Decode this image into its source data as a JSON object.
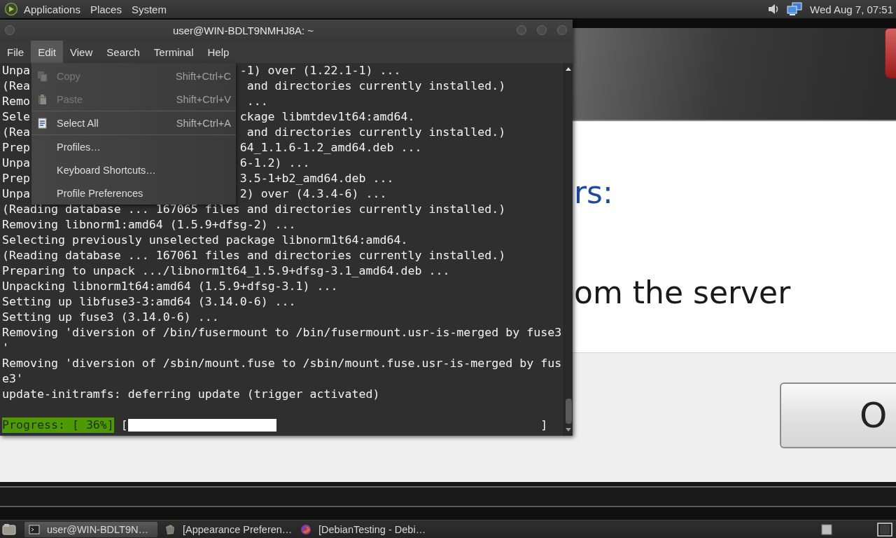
{
  "top_panel": {
    "menus": [
      "Applications",
      "Places",
      "System"
    ],
    "clock": "Wed Aug 7, 07:51"
  },
  "background_dialog": {
    "heading": "rs:",
    "message": "om the server",
    "button": "O"
  },
  "terminal": {
    "title": "user@WIN-BDLT9NMHJ8A: ~",
    "menubar": [
      {
        "label": "File",
        "selected": false
      },
      {
        "label": "Edit",
        "selected": true
      },
      {
        "label": "View",
        "selected": false
      },
      {
        "label": "Search",
        "selected": false
      },
      {
        "label": "Terminal",
        "selected": false
      },
      {
        "label": "Help",
        "selected": false
      }
    ],
    "lines": [
      {
        "left": "Unpa",
        "right": "-1) over (1.22.1-1) ..."
      },
      {
        "left": "(Rea",
        "right": " and directories currently installed.)"
      },
      {
        "left": "Remo",
        "right": " ..."
      },
      {
        "left": "Sele",
        "right": "ckage libmtdev1t64:amd64."
      },
      {
        "left": "(Rea",
        "right": " and directories currently installed.)"
      },
      {
        "left": "Prep",
        "right": "64_1.1.6-1.2_amd64.deb ..."
      },
      {
        "left": "Unpa",
        "right": "6-1.2) ..."
      },
      {
        "left": "Prep",
        "right": "3.5-1+b2_amd64.deb ..."
      },
      {
        "left": "Unpa",
        "right": "2) over (4.3.4-6) ..."
      },
      {
        "text": "(Reading database ... 167065 files and directories currently installed.)"
      },
      {
        "text": "Removing libnorm1:amd64 (1.5.9+dfsg-2) ..."
      },
      {
        "text": "Selecting previously unselected package libnorm1t64:amd64."
      },
      {
        "text": "(Reading database ... 167061 files and directories currently installed.)"
      },
      {
        "text": "Preparing to unpack .../libnorm1t64_1.5.9+dfsg-3.1_amd64.deb ..."
      },
      {
        "text": "Unpacking libnorm1t64:amd64 (1.5.9+dfsg-3.1) ..."
      },
      {
        "text": "Setting up libfuse3-3:amd64 (3.14.0-6) ..."
      },
      {
        "text": "Setting up fuse3 (3.14.0-6) ..."
      },
      {
        "text": "Removing 'diversion of /bin/fusermount to /bin/fusermount.usr-is-merged by fuse3"
      },
      {
        "text": "'"
      },
      {
        "text": "Removing 'diversion of /sbin/mount.fuse to /sbin/mount.fuse.usr-is-merged by fus"
      },
      {
        "text": "e3'"
      },
      {
        "text": "update-initramfs: deferring update (trigger activated)"
      }
    ],
    "progress": {
      "label": "Progress: [ 36%]",
      "open": "[",
      "close": "]",
      "level": 0.36
    },
    "edit_menu": {
      "sections": [
        [
          {
            "kind": "copy",
            "label": "Copy",
            "shortcut": "Shift+Ctrl+C",
            "disabled": true
          },
          {
            "kind": "paste",
            "label": "Paste",
            "shortcut": "Shift+Ctrl+V",
            "disabled": true
          }
        ],
        [
          {
            "kind": "selectall",
            "label": "Select All",
            "shortcut": "Shift+Ctrl+A",
            "disabled": false
          }
        ],
        [
          {
            "kind": "plain",
            "label": "Profiles…",
            "disabled": false
          },
          {
            "kind": "plain",
            "label": "Keyboard Shortcuts…",
            "disabled": false
          },
          {
            "kind": "plain",
            "label": "Profile Preferences",
            "disabled": false
          }
        ]
      ]
    }
  },
  "taskbar": {
    "tasks": [
      {
        "kind": "terminal",
        "label": "user@WIN-BDLT9N…",
        "selected": true
      },
      {
        "kind": "appearance",
        "label": "[Appearance Preferen…",
        "selected": false
      },
      {
        "kind": "browser",
        "label": "[DebianTesting - Debi…",
        "selected": false
      }
    ]
  }
}
